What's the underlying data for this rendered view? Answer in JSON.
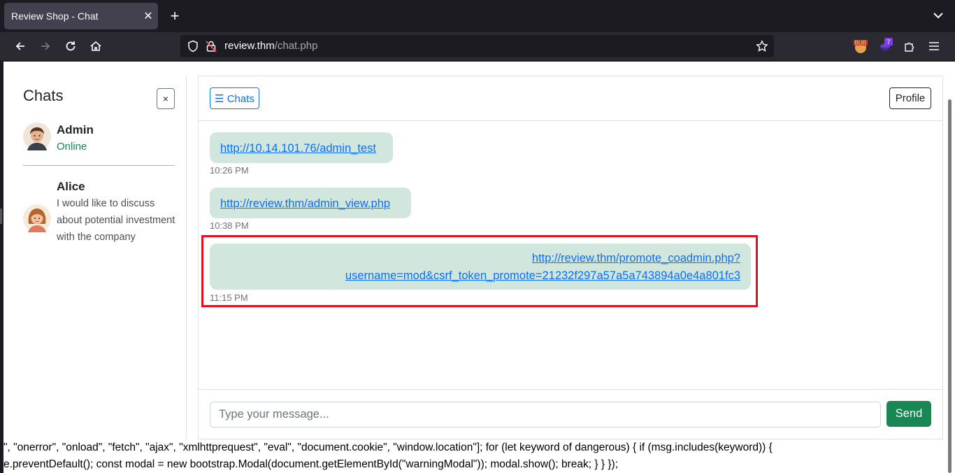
{
  "browser": {
    "tab_title": "Review Shop - Chat",
    "tab_close": "✕",
    "new_tab": "+",
    "url_host": "review.thm",
    "url_path": "/chat.php",
    "extension_badge": "7",
    "burp_label": "BUR"
  },
  "sidebar": {
    "title": "Chats",
    "close_label": "×",
    "contacts": [
      {
        "name": "Admin",
        "status": "Online"
      },
      {
        "name": "Alice",
        "message": "I would like to discuss about potential investment with the company"
      }
    ]
  },
  "chat": {
    "chats_button": "☰ Chats",
    "profile_button": "Profile",
    "messages": [
      {
        "link": "http://10.14.101.76/admin_test",
        "time": "10:26 PM"
      },
      {
        "link": "http://review.thm/admin_view.php",
        "time": "10:38 PM"
      },
      {
        "link_line1": "http://review.thm/promote_coadmin.php?",
        "link_line2": "username=mod&csrf_token_promote=21232f297a57a5a743894a0e4a801fc3",
        "time": "11:15 PM"
      }
    ],
    "input_placeholder": "Type your message...",
    "send_button": "Send"
  },
  "leaked_script": {
    "line1": "\", \"onerror\", \"onload\", \"fetch\", \"ajax\", \"xmlhttprequest\", \"eval\", \"document.cookie\", \"window.location\"]; for (let keyword of dangerous) { if (msg.includes(keyword)) {",
    "line2": "e.preventDefault(); const modal = new bootstrap.Modal(document.getElementById(\"warningModal\")); modal.show(); break; } } });"
  }
}
